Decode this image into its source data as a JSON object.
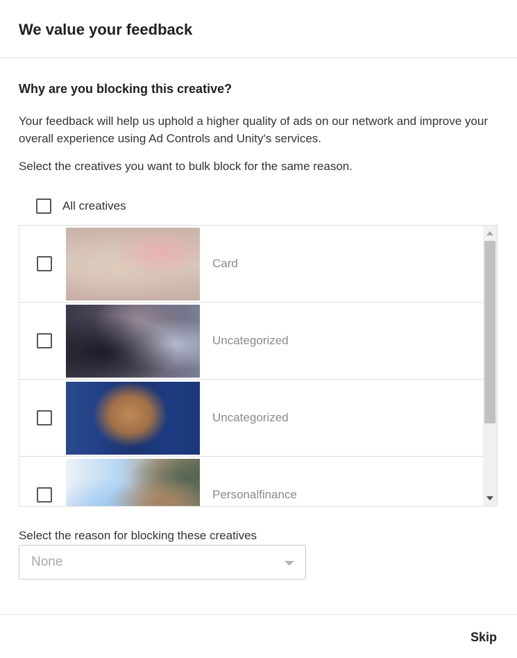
{
  "header": {
    "title": "We value your feedback"
  },
  "content": {
    "question": "Why are you blocking this creative?",
    "description": "Your feedback will help us uphold a higher quality of ads on our network and improve your overall experience using Ad Controls and Unity's services.",
    "instruction": "Select the creatives you want to bulk block for the same reason.",
    "all_creatives_label": "All creatives",
    "creatives": [
      {
        "label": "Card",
        "checked": false
      },
      {
        "label": "Uncategorized",
        "checked": false
      },
      {
        "label": "Uncategorized",
        "checked": false
      },
      {
        "label": "Personalfinance",
        "checked": false
      }
    ]
  },
  "reason": {
    "label": "Select the reason for blocking these creatives",
    "selected": "None"
  },
  "footer": {
    "skip_label": "Skip"
  }
}
